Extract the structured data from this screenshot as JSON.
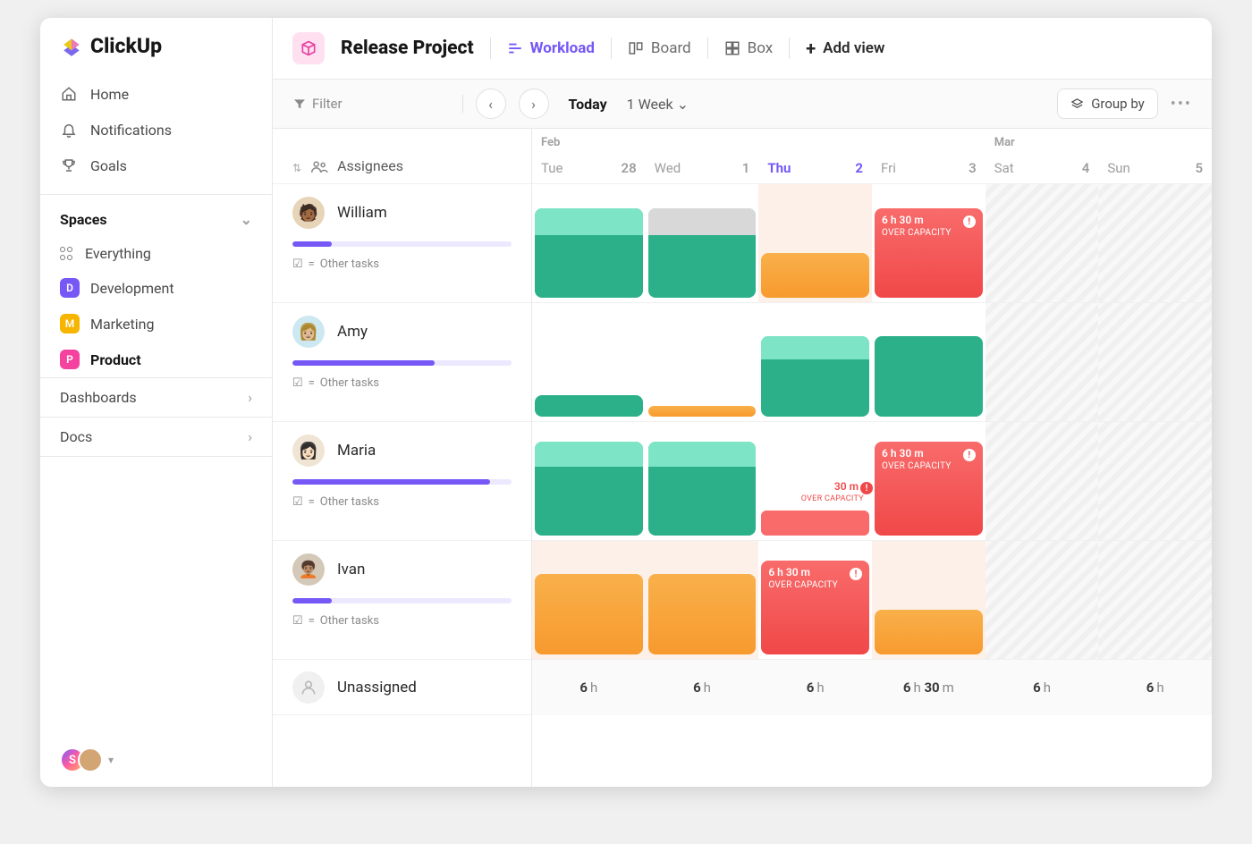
{
  "brand": "ClickUp",
  "sidebar": {
    "nav": [
      {
        "label": "Home",
        "icon": "home"
      },
      {
        "label": "Notifications",
        "icon": "bell"
      },
      {
        "label": "Goals",
        "icon": "trophy"
      }
    ],
    "spaces_label": "Spaces",
    "everything_label": "Everything",
    "spaces": [
      {
        "label": "Development",
        "letter": "D",
        "color": "#7558f6"
      },
      {
        "label": "Marketing",
        "letter": "M",
        "color": "#f7b500"
      },
      {
        "label": "Product",
        "letter": "P",
        "color": "#f4429e",
        "active": true
      }
    ],
    "dashboards_label": "Dashboards",
    "docs_label": "Docs",
    "workspace_letter": "S"
  },
  "header": {
    "project_title": "Release Project",
    "views": [
      {
        "label": "Workload",
        "active": true
      },
      {
        "label": "Board"
      },
      {
        "label": "Box"
      }
    ],
    "add_view": "Add view"
  },
  "toolbar": {
    "filter_label": "Filter",
    "today_label": "Today",
    "range_label": "1 Week",
    "group_by_label": "Group by"
  },
  "grid": {
    "assignees_label": "Assignees",
    "other_tasks_label": "Other tasks",
    "unassigned_label": "Unassigned",
    "over_capacity_label": "OVER CAPACITY",
    "days": [
      {
        "month": "Feb",
        "name": "Tue",
        "num": "28"
      },
      {
        "month": "",
        "name": "Wed",
        "num": "1"
      },
      {
        "month": "",
        "name": "Thu",
        "num": "2",
        "today": true
      },
      {
        "month": "",
        "name": "Fri",
        "num": "3"
      },
      {
        "month": "Mar",
        "name": "Sat",
        "num": "4",
        "weekend": true
      },
      {
        "month": "",
        "name": "Sun",
        "num": "5",
        "weekend": true
      }
    ],
    "assignees": [
      {
        "name": "William",
        "progress": 18,
        "avatar_bg": "#e8d4b8"
      },
      {
        "name": "Amy",
        "progress": 65,
        "avatar_bg": "#cde8f0"
      },
      {
        "name": "Maria",
        "progress": 90,
        "avatar_bg": "#f0e4d4"
      },
      {
        "name": "Ivan",
        "progress": 18,
        "avatar_bg": "#d4c8b8"
      }
    ],
    "over_capacity": {
      "william_fri": "6 h 30 m",
      "maria_thu": "30 m",
      "maria_fri": "6 h 30 m",
      "ivan_thu": "6 h 30 m"
    },
    "footer": [
      {
        "h": "6",
        "m": ""
      },
      {
        "h": "6",
        "m": ""
      },
      {
        "h": "6",
        "m": ""
      },
      {
        "h": "6",
        "m": "30"
      },
      {
        "h": "6",
        "m": ""
      },
      {
        "h": "6",
        "m": ""
      }
    ]
  }
}
